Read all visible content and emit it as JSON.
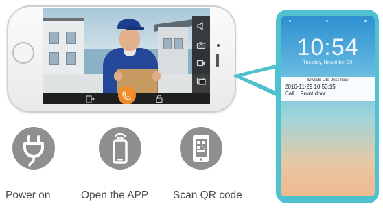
{
  "app_screen": {
    "side_controls": [
      {
        "icon": "speaker-icon"
      },
      {
        "icon": "camera-icon"
      },
      {
        "icon": "video-record-icon"
      },
      {
        "icon": "album-icon"
      }
    ],
    "bottom_controls": [
      {
        "icon": "door-unlock-icon"
      },
      {
        "icon": "answer-call-icon"
      },
      {
        "icon": "lock-icon"
      }
    ],
    "accent_color": "#f08c2a"
  },
  "lock_screen": {
    "time": "10:54",
    "date": "Tuesday, November 29",
    "notification": {
      "app": "iDMSS Lite  Just now",
      "timestamp": "2016-11-29 10:53:15",
      "message": "Call    Front door"
    },
    "frame_color": "#4ec0d0"
  },
  "steps": [
    {
      "icon": "power-plug-icon",
      "label": "Power on"
    },
    {
      "icon": "smartphone-wifi-icon",
      "label": "Open the APP"
    },
    {
      "icon": "qr-code-phone-icon",
      "label": "Scan QR code"
    }
  ]
}
